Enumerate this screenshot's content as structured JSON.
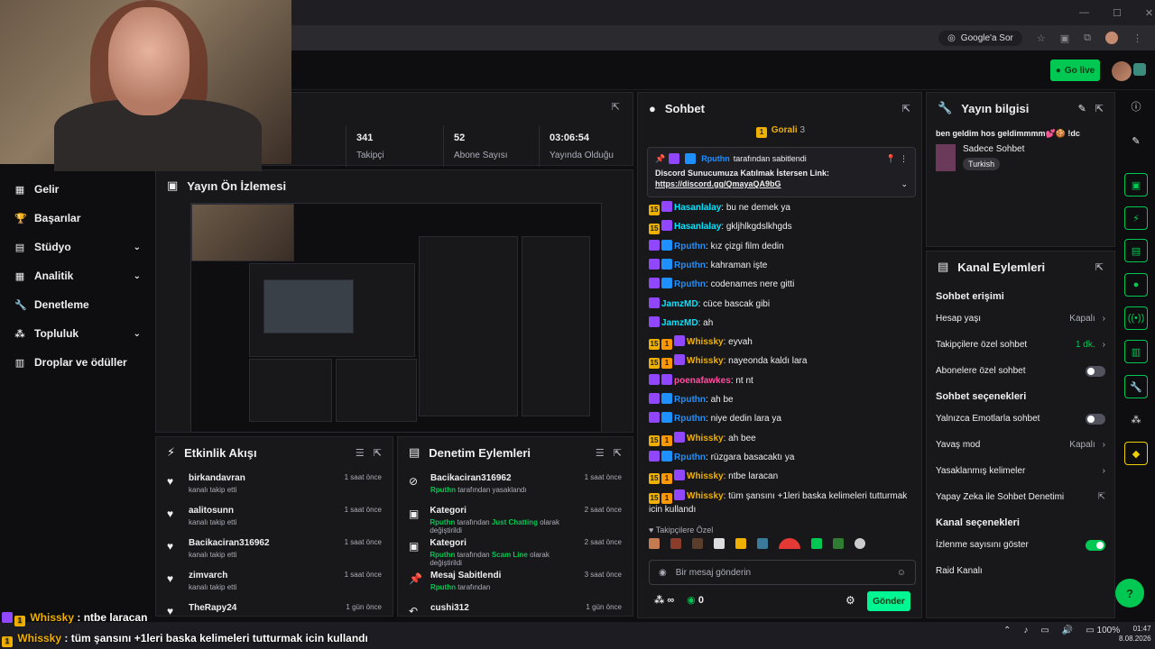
{
  "browser": {
    "google_label": "Google'a Sor",
    "win_min": "—",
    "win_max": "☐",
    "win_close": "✕"
  },
  "topbar": {
    "golive_label": "Go live"
  },
  "sidebar": {
    "items": [
      {
        "label": "Gelir",
        "icon": "money-icon"
      },
      {
        "label": "Başarılar",
        "icon": "trophy-icon"
      },
      {
        "label": "Stüdyo",
        "icon": "studio-icon",
        "chevron": true
      },
      {
        "label": "Analitik",
        "icon": "chart-icon",
        "chevron": true
      },
      {
        "label": "Denetleme",
        "icon": "wrench-icon"
      },
      {
        "label": "Topluluk",
        "icon": "community-icon",
        "chevron": true
      },
      {
        "label": "Droplar ve ödüller",
        "icon": "drops-icon"
      }
    ]
  },
  "stats": [
    {
      "value": "341",
      "label": "Takipçi"
    },
    {
      "value": "52",
      "label": "Abone Sayısı"
    },
    {
      "value": "03:06:54",
      "label": "Yayında Olduğu"
    }
  ],
  "preview": {
    "title": "Yayın Ön İzlemesi"
  },
  "activity": {
    "title": "Etkinlik Akışı",
    "items": [
      {
        "name": "birkandavran",
        "sub": "kanalı takip etti",
        "time": "1 saat önce"
      },
      {
        "name": "aalitosunn",
        "sub": "kanalı takip etti",
        "time": "1 saat önce"
      },
      {
        "name": "Bacikaciran316962",
        "sub": "kanalı takip etti",
        "time": "1 saat önce"
      },
      {
        "name": "zimvarch",
        "sub": "kanalı takip etti",
        "time": "1 saat önce"
      },
      {
        "name": "TheRapy24",
        "sub": "",
        "time": "1 gün önce"
      }
    ]
  },
  "modact": {
    "title": "Denetim Eylemleri",
    "items": [
      {
        "name": "Bacikaciran316962",
        "user": "Rputhn",
        "rest": "tarafından yasaklandı",
        "time": "1 saat önce",
        "icon": "ban-icon"
      },
      {
        "name": "Kategori",
        "user": "Rputhn",
        "rest": "tarafından",
        "hl": "Just Chatting",
        "rest2": "olarak değiştirildi",
        "time": "2 saat önce",
        "icon": "category-icon"
      },
      {
        "name": "Kategori",
        "user": "Rputhn",
        "rest": "tarafından",
        "hl": "Scam Line",
        "rest2": "olarak değiştirildi",
        "time": "2 saat önce",
        "icon": "category-icon"
      },
      {
        "name": "Mesaj Sabitlendi",
        "user": "Rputhn",
        "rest": "tarafından",
        "time": "3 saat önce",
        "icon": "pin-icon"
      },
      {
        "name": "cushi312",
        "user": "",
        "rest": "",
        "time": "1 gün önce",
        "icon": "undo-icon"
      }
    ]
  },
  "chat": {
    "title": "Sohbet",
    "top_gifter": "Gorali",
    "top_count": "3",
    "pinned": {
      "by": "Rputhn",
      "by_suffix": "tarafından sabitlendi",
      "text": "Discord Sunucumuza Katılmak İstersen Link:",
      "link": "https://discord.gg/QmayaQA9bG"
    },
    "messages": [
      {
        "user": "Hasanlalay",
        "color": "#00e5ff",
        "text": "bu ne demek ya",
        "badges": [
          "bg",
          "bp"
        ]
      },
      {
        "user": "Hasanlalay",
        "color": "#00e5ff",
        "text": "gkljhlkgdslkhgds",
        "badges": [
          "bg",
          "bp"
        ]
      },
      {
        "user": "Rputhn",
        "color": "#1e90ff",
        "text": "kız çizgi film dedin",
        "badges": [
          "bp",
          "bs"
        ]
      },
      {
        "user": "Rputhn",
        "color": "#1e90ff",
        "text": "kahraman işte",
        "badges": [
          "bp",
          "bs"
        ]
      },
      {
        "user": "Rputhn",
        "color": "#1e90ff",
        "text": "codenames nere gitti",
        "badges": [
          "bp",
          "bs"
        ]
      },
      {
        "user": "JamzMD",
        "color": "#00e5ff",
        "text": "cüce bascak gibi",
        "badges": [
          "bp"
        ]
      },
      {
        "user": "JamzMD",
        "color": "#00e5ff",
        "text": "ah",
        "badges": [
          "bp"
        ]
      },
      {
        "user": "Whissky",
        "color": "#f0b000",
        "text": "eyvah",
        "badges": [
          "bg",
          "bo",
          "bp"
        ]
      },
      {
        "user": "Whissky",
        "color": "#f0b000",
        "text": "nayeonda kaldı lara",
        "badges": [
          "bg",
          "bo",
          "bp"
        ]
      },
      {
        "user": "poenafawkes",
        "color": "#ff4fa0",
        "text": "nt nt",
        "badges": [
          "bp",
          "bp"
        ]
      },
      {
        "user": "Rputhn",
        "color": "#1e90ff",
        "text": "ah be",
        "badges": [
          "bp",
          "bs"
        ]
      },
      {
        "user": "Rputhn",
        "color": "#1e90ff",
        "text": "niye dedin lara ya",
        "badges": [
          "bp",
          "bs"
        ]
      },
      {
        "user": "Whissky",
        "color": "#f0b000",
        "text": "ah bee",
        "badges": [
          "bg",
          "bo",
          "bp"
        ]
      },
      {
        "user": "Rputhn",
        "color": "#1e90ff",
        "text": "rüzgara basacaktı ya",
        "badges": [
          "bp",
          "bs"
        ]
      },
      {
        "user": "Whissky",
        "color": "#f0b000",
        "text": "ntbe laracan",
        "badges": [
          "bg",
          "bo",
          "bp"
        ]
      },
      {
        "user": "Whissky",
        "color": "#f0b000",
        "text": "tüm şansını +1leri baska kelimeleri tutturmak icin kullandı",
        "badges": [
          "bg",
          "bo",
          "bp"
        ]
      }
    ],
    "followers_only": "Takipçilere Özel",
    "input_placeholder": "Bir mesaj gönderin",
    "infinity": "∞",
    "points": "0",
    "send_label": "Gönder"
  },
  "info": {
    "title": "Yayın bilgisi",
    "stream_title": "ben geldim hos geldimmmm💕🍪 !dc",
    "category": "Sadece Sohbet",
    "tag": "Turkish"
  },
  "actions": {
    "title": "Kanal Eylemleri",
    "sec1": "Sohbet erişimi",
    "account_age": "Hesap yaşı",
    "account_age_val": "Kapalı",
    "followers_chat": "Takipçilere özel sohbet",
    "followers_chat_val": "1 dk.",
    "subs_chat": "Abonelere özel sohbet",
    "sec2": "Sohbet seçenekleri",
    "emote_only": "Yalnızca Emotlarla sohbet",
    "slow_mode": "Yavaş mod",
    "slow_mode_val": "Kapalı",
    "banned_words": "Yasaklanmış kelimeler",
    "ai_mod": "Yapay Zeka ile Sohbet Denetimi",
    "sec3": "Kanal seçenekleri",
    "viewer_count": "İzlenme sayısını göster",
    "raid": "Raid Kanalı"
  },
  "overlay": [
    {
      "user": "Whissky",
      "text": ": ntbe laracan"
    },
    {
      "user": "Whissky",
      "text": ": tüm şansını +1leri baska kelimeleri tutturmak icin kullandı"
    }
  ],
  "taskbar": {
    "battery": "100%",
    "time": "01:47",
    "date": "8.08.2026"
  }
}
